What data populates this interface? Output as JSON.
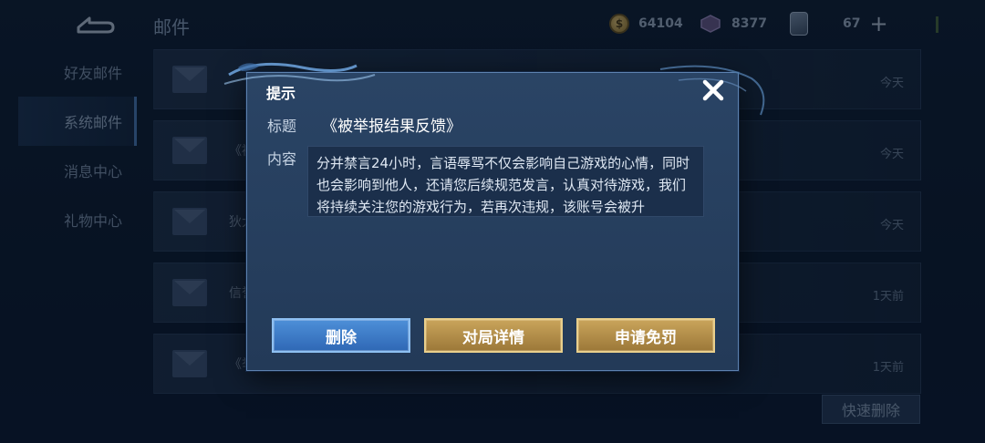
{
  "header": {
    "title": "邮件",
    "coins": "64104",
    "gems": "8377",
    "cards": "67"
  },
  "sidebar": {
    "items": [
      {
        "label": "好友邮件"
      },
      {
        "label": "系统邮件"
      },
      {
        "label": "消息中心"
      },
      {
        "label": "礼物中心"
      }
    ]
  },
  "mail_list": [
    {
      "subject": "",
      "date": "今天"
    },
    {
      "subject": "《被",
      "date": "今天"
    },
    {
      "subject": "狄大",
      "date": "今天"
    },
    {
      "subject": "信誉",
      "date": "1天前"
    },
    {
      "subject": "《举",
      "date": "1天前"
    }
  ],
  "quick_delete_label": "快速删除",
  "dialog": {
    "title": "提示",
    "title_label": "标题",
    "title_value": "《被举报结果反馈》",
    "content_label": "内容",
    "content": "分并禁言24小时，言语辱骂不仅会影响自己游戏的心情，同时也会影响到他人，还请您后续规范发言，认真对待游戏，我们将持续关注您的游戏行为，若再次违规，该账号会被升",
    "buttons": {
      "delete": "删除",
      "match_details": "对局详情",
      "appeal": "申请免罚"
    }
  },
  "colors": {
    "delete_button": "#3a7bc8",
    "gold_button": "#b48c48",
    "dialog_bg": "#233a58"
  }
}
